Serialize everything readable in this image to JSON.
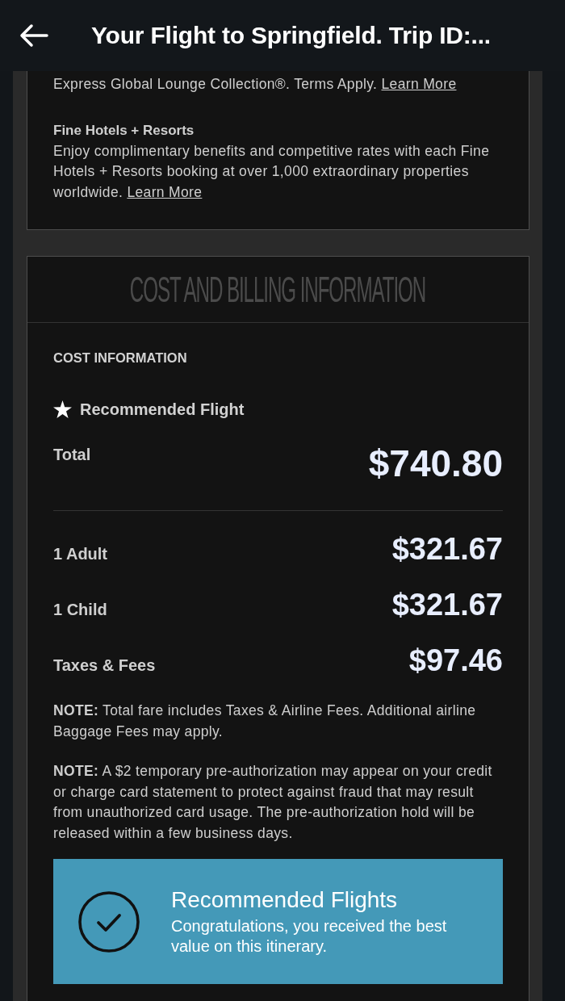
{
  "header": {
    "title": "Your Flight to Springfield. Trip ID:..."
  },
  "benefits": [
    {
      "text": "Express Global Lounge Collection®. Terms Apply.",
      "link": "Learn More"
    },
    {
      "title": "Fine Hotels + Resorts",
      "text": "Enjoy complimentary benefits and competitive rates with each Fine Hotels + Resorts booking at over 1,000 extraordinary properties worldwide.",
      "link": "Learn More"
    }
  ],
  "billing": {
    "title": "COST AND BILLING INFORMATION",
    "section_label": "COST INFORMATION",
    "recommended_label": "Recommended Flight",
    "total": {
      "label": "Total",
      "amount": "$740.80"
    },
    "line_items": [
      {
        "label": "1 Adult",
        "amount": "$321.67"
      },
      {
        "label": "1 Child",
        "amount": "$321.67"
      },
      {
        "label": "Taxes & Fees",
        "amount": "$97.46"
      }
    ],
    "notes": [
      "**NOTE:** Total fare includes Taxes & Airline Fees. Additional airline Baggage Fees may apply.",
      "**NOTE:** A $2 temporary pre-authorization may appear on your credit or charge card statement to protect against fraud that may result from unauthorized card usage. The pre-authorization hold will be released within a few business days."
    ],
    "banner": {
      "title": "Recommended Flights",
      "text": "Congratulations, you received the best value on this itinerary."
    }
  }
}
